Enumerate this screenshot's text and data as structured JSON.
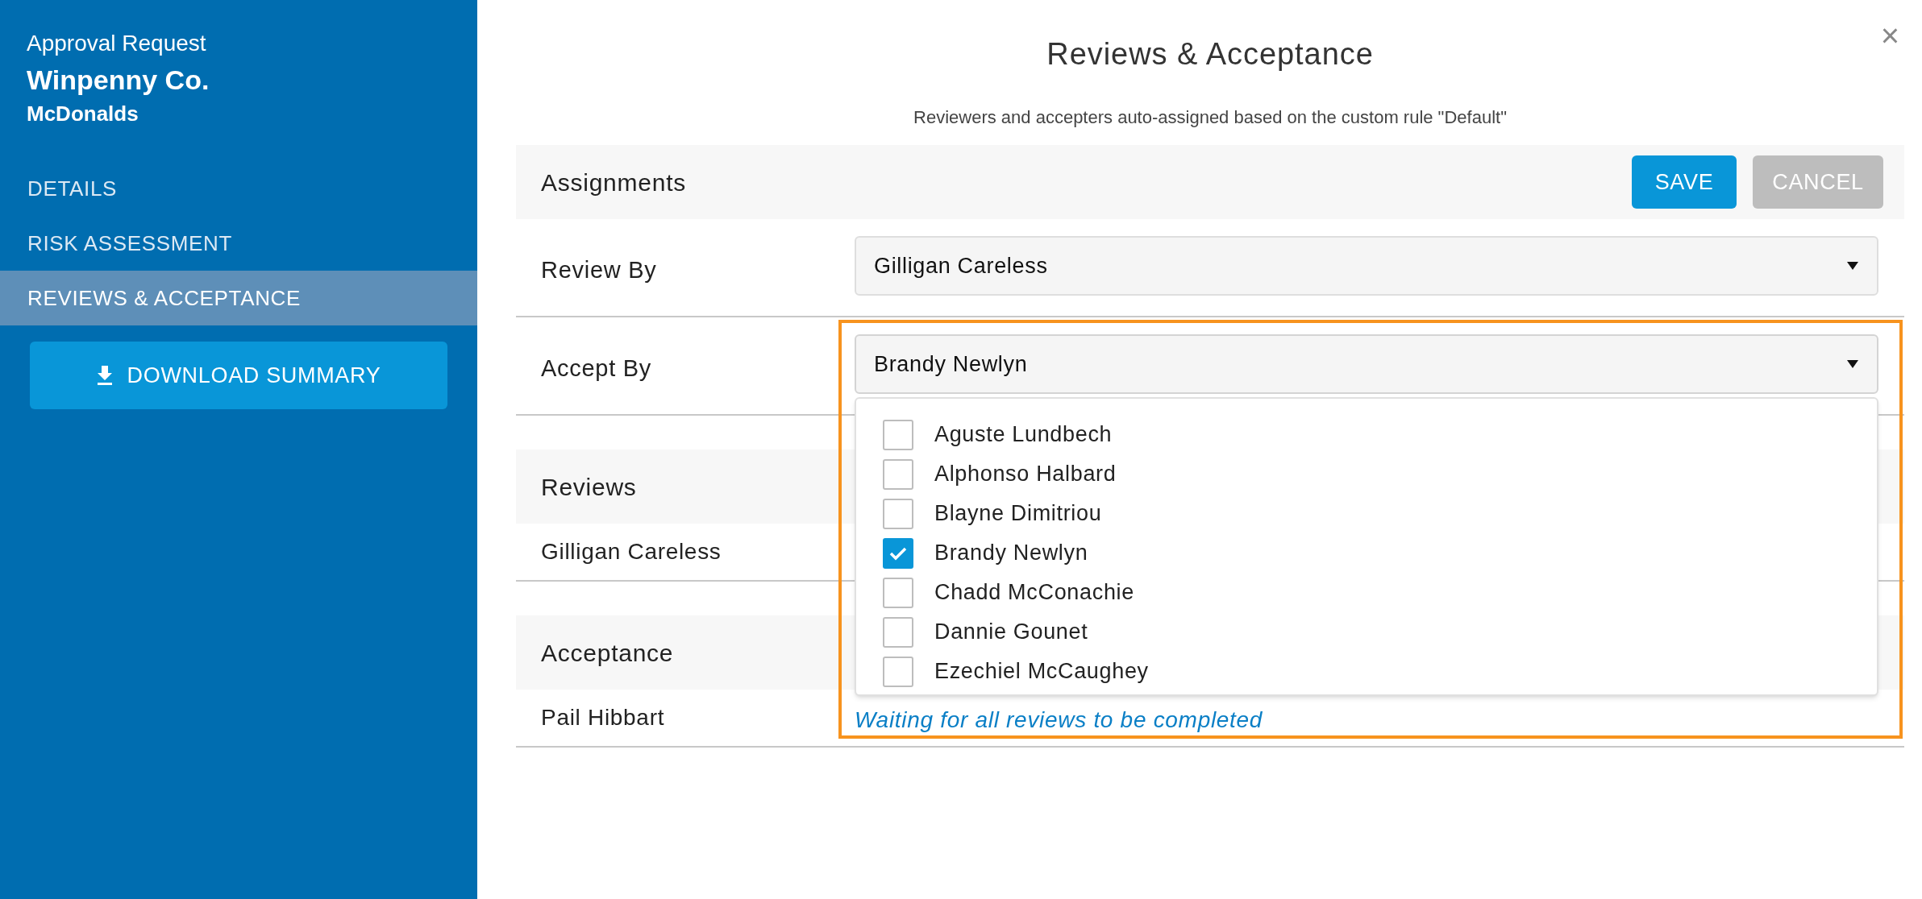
{
  "sidebar": {
    "eyebrow": "Approval Request",
    "title": "Winpenny Co.",
    "subtitle": "McDonalds",
    "nav": [
      {
        "label": "DETAILS",
        "selected": false
      },
      {
        "label": "RISK ASSESSMENT",
        "selected": false
      },
      {
        "label": "REVIEWS & ACCEPTANCE",
        "selected": true
      }
    ],
    "download_button": "DOWNLOAD SUMMARY"
  },
  "dialog": {
    "title": "Reviews & Acceptance",
    "close": "×",
    "note": "Reviewers and accepters auto-assigned based on the custom rule \"Default\"",
    "assignments": {
      "heading": "Assignments",
      "save": "SAVE",
      "cancel": "CANCEL",
      "fields": [
        {
          "label": "Review By",
          "value": "Gilligan Careless",
          "expanded": false,
          "highlighted": false
        },
        {
          "label": "Accept By",
          "value": "Brandy Newlyn",
          "expanded": true,
          "highlighted": true,
          "options": [
            {
              "label": "Aguste Lundbech",
              "checked": false
            },
            {
              "label": "Alphonso Halbard",
              "checked": false
            },
            {
              "label": "Blayne Dimitriou",
              "checked": false
            },
            {
              "label": "Brandy Newlyn",
              "checked": true
            },
            {
              "label": "Chadd McConachie",
              "checked": false
            },
            {
              "label": "Dannie Gounet",
              "checked": false
            },
            {
              "label": "Ezechiel McCaughey",
              "checked": false
            }
          ]
        }
      ]
    },
    "sections": [
      {
        "heading": "Reviews",
        "rows": [
          {
            "name": "Gilligan Careless"
          }
        ]
      },
      {
        "heading": "Acceptance",
        "rows": [
          {
            "name": "Pail Hibbart",
            "status": "Waiting for all reviews to be completed"
          }
        ]
      }
    ]
  }
}
